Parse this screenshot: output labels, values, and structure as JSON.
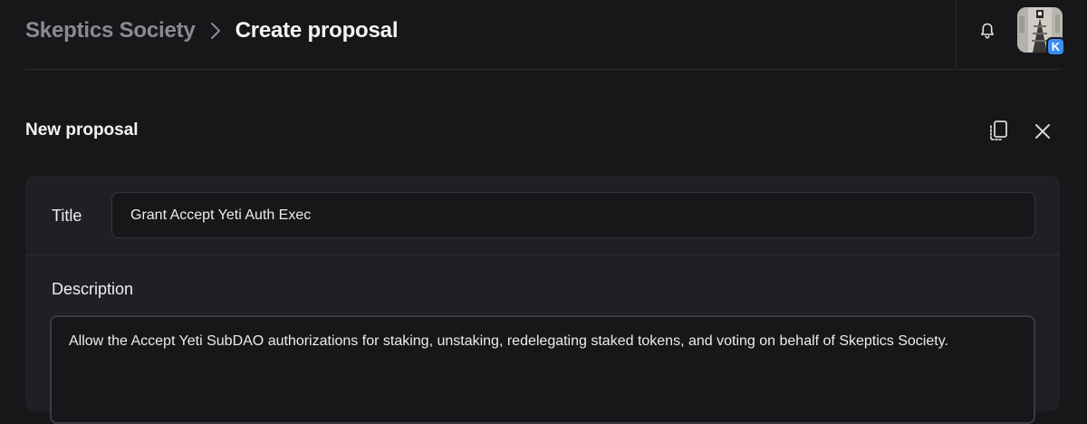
{
  "header": {
    "breadcrumb_parent": "Skeptics Society",
    "breadcrumb_current": "Create proposal",
    "notification_icon": "bell-icon",
    "avatar_badge": "K"
  },
  "form": {
    "section_title": "New proposal",
    "actions": {
      "duplicate_icon": "copy-icon",
      "close_icon": "close-icon"
    },
    "title_label": "Title",
    "title_value": "Grant Accept Yeti Auth Exec",
    "description_label": "Description",
    "description_value": "Allow the Accept Yeti SubDAO authorizations for staking, unstaking, redelegating staked tokens, and voting on behalf of Skeptics Society."
  },
  "colors": {
    "background": "#17171a",
    "card": "#1f2023",
    "muted_text": "#8a8b91",
    "badge": "#3a8df0"
  }
}
